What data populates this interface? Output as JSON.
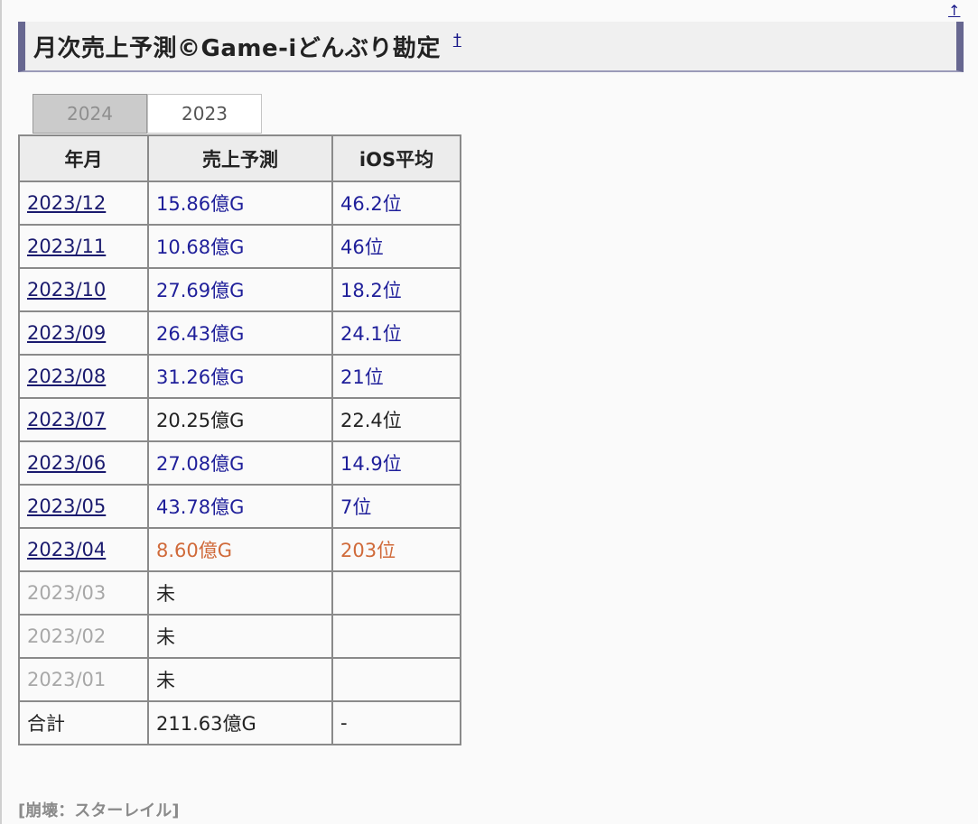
{
  "page": {
    "top_link": "↑"
  },
  "heading": {
    "title": "月次売上予測©Game-iどんぶり勘定",
    "anchor": "†"
  },
  "tabs": [
    {
      "label": "2024",
      "active": true
    },
    {
      "label": "2023",
      "active": false
    }
  ],
  "table": {
    "headers": [
      "年月",
      "売上予測",
      "iOS平均"
    ],
    "rows": [
      {
        "month": "2023/12",
        "sales": "15.86億G",
        "ios": "46.2位",
        "link": true,
        "tone": "blue"
      },
      {
        "month": "2023/11",
        "sales": "10.68億G",
        "ios": "46位",
        "link": true,
        "tone": "blue"
      },
      {
        "month": "2023/10",
        "sales": "27.69億G",
        "ios": "18.2位",
        "link": true,
        "tone": "blue"
      },
      {
        "month": "2023/09",
        "sales": "26.43億G",
        "ios": "24.1位",
        "link": true,
        "tone": "blue"
      },
      {
        "month": "2023/08",
        "sales": "31.26億G",
        "ios": "21位",
        "link": true,
        "tone": "blue"
      },
      {
        "month": "2023/07",
        "sales": "20.25億G",
        "ios": "22.4位",
        "link": true,
        "tone": "dark"
      },
      {
        "month": "2023/06",
        "sales": "27.08億G",
        "ios": "14.9位",
        "link": true,
        "tone": "blue"
      },
      {
        "month": "2023/05",
        "sales": "43.78億G",
        "ios": "7位",
        "link": true,
        "tone": "blue"
      },
      {
        "month": "2023/04",
        "sales": "8.60億G",
        "ios": "203位",
        "link": true,
        "tone": "orange"
      },
      {
        "month": "2023/03",
        "sales": "未",
        "ios": "",
        "link": false,
        "tone": "dark"
      },
      {
        "month": "2023/02",
        "sales": "未",
        "ios": "",
        "link": false,
        "tone": "dark"
      },
      {
        "month": "2023/01",
        "sales": "未",
        "ios": "",
        "link": false,
        "tone": "dark"
      }
    ],
    "total": {
      "label": "合計",
      "sales": "211.63億G",
      "ios": "-"
    }
  },
  "footer": {
    "text": "[崩壊：スターレイル]"
  },
  "colors": {
    "heading_bar": "#676790",
    "link": "#1a1a6e",
    "blue_value": "#1f1f9a",
    "orange_value": "#d06a3a",
    "muted": "#a8a8a8"
  }
}
